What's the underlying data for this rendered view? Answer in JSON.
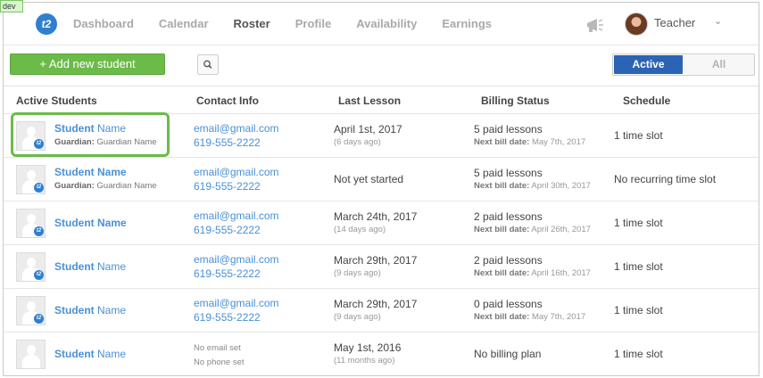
{
  "dev_badge": "dev",
  "nav": {
    "logo": "t2",
    "items": [
      {
        "label": "Dashboard",
        "active": false
      },
      {
        "label": "Calendar",
        "active": false
      },
      {
        "label": "Roster",
        "active": true
      },
      {
        "label": "Profile",
        "active": false
      },
      {
        "label": "Availability",
        "active": false
      },
      {
        "label": "Earnings",
        "active": false
      }
    ],
    "user_name": "Teacher",
    "caret": "⌄"
  },
  "toolbar": {
    "add_label": "+ Add new student",
    "toggle": {
      "active": "Active",
      "all": "All"
    }
  },
  "table": {
    "headers": [
      "Active Students",
      "Contact Info",
      "Last Lesson",
      "Billing Status",
      "Schedule"
    ],
    "rows": [
      {
        "student_first": "Student",
        "student_last": "Name",
        "guardian_label": "Guardian:",
        "guardian_name": "Guardian Name",
        "email": "email@gmail.com",
        "phone": "619-555-2222",
        "last_lesson": "April 1st, 2017",
        "last_lesson_ago": "(6 days ago)",
        "billing": "5 paid lessons",
        "next_bill_label": "Next bill date:",
        "next_bill": "May 7th, 2017",
        "schedule": "1 time slot"
      },
      {
        "student_first": "Student",
        "student_last": "Name",
        "guardian_label": "Guardian:",
        "guardian_name": "Guardian Name",
        "email": "email@gmail.com",
        "phone": "619-555-2222",
        "last_lesson": "Not yet started",
        "last_lesson_ago": "",
        "billing": "5 paid lessons",
        "next_bill_label": "Next bill date:",
        "next_bill": "April 30th, 2017",
        "schedule": "No recurring time slot"
      },
      {
        "student_first": "Student",
        "student_last": "Name",
        "guardian_label": "",
        "guardian_name": "",
        "email": "email@gmail.com",
        "phone": "619-555-2222",
        "last_lesson": "March 24th, 2017",
        "last_lesson_ago": "(14 days ago)",
        "billing": "2 paid lessons",
        "next_bill_label": "Next bill date:",
        "next_bill": "April 26th, 2017",
        "schedule": "1 time slot"
      },
      {
        "student_first": "Student",
        "student_last": "Name",
        "guardian_label": "",
        "guardian_name": "",
        "email": "email@gmail.com",
        "phone": "619-555-2222",
        "last_lesson": "March 29th, 2017",
        "last_lesson_ago": "(9 days ago)",
        "billing": "2 paid lessons",
        "next_bill_label": "Next bill date:",
        "next_bill": "April 16th, 2017",
        "schedule": "1 time slot"
      },
      {
        "student_first": "Student",
        "student_last": "Name",
        "guardian_label": "",
        "guardian_name": "",
        "email": "email@gmail.com",
        "phone": "619-555-2222",
        "last_lesson": "March 29th, 2017",
        "last_lesson_ago": "(9 days ago)",
        "billing": "0 paid lessons",
        "next_bill_label": "Next bill date:",
        "next_bill": "May 7th, 2017",
        "schedule": "1 time slot"
      },
      {
        "student_first": "Student",
        "student_last": "Name",
        "guardian_label": "",
        "guardian_name": "",
        "email": "No email set",
        "phone": "No phone set",
        "last_lesson": "May 1st, 2016",
        "last_lesson_ago": "(11 months ago)",
        "billing": "No billing plan",
        "next_bill_label": "",
        "next_bill": "",
        "schedule": "1 time slot"
      }
    ]
  },
  "colors": {
    "accent_green": "#6cbb49",
    "brand_blue": "#2c64b5",
    "link_blue": "#4a90d6"
  },
  "icons": {
    "search": "search-icon",
    "megaphone": "megaphone-icon"
  }
}
